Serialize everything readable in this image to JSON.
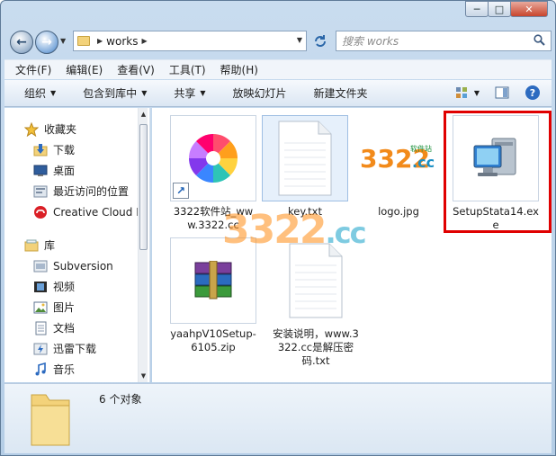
{
  "window": {
    "caption": {
      "minimize": "─",
      "maximize": "□",
      "close": "✕"
    }
  },
  "address": {
    "path": "works",
    "search_placeholder": "搜索 works"
  },
  "menu": [
    "文件(F)",
    "编辑(E)",
    "查看(V)",
    "工具(T)",
    "帮助(H)"
  ],
  "toolbar": {
    "organize": "组织",
    "include_library": "包含到库中",
    "share": "共享",
    "slideshow": "放映幻灯片",
    "new_folder": "新建文件夹"
  },
  "sidebar": {
    "favorites": "收藏夹",
    "favorites_items": [
      "下载",
      "桌面",
      "最近访问的位置",
      "Creative Cloud Fi"
    ],
    "libraries": "库",
    "library_items": [
      "Subversion",
      "视频",
      "图片",
      "文档",
      "迅雷下载",
      "音乐"
    ]
  },
  "files": [
    {
      "name": "3322软件站_www.3322.cc",
      "kind": "shortcut"
    },
    {
      "name": "key.txt",
      "kind": "text"
    },
    {
      "name": "logo.jpg",
      "kind": "image"
    },
    {
      "name": "SetupStata14.exe",
      "kind": "exe"
    },
    {
      "name": "yaahpV10Setup-6105.zip",
      "kind": "zip"
    },
    {
      "name": "安装说明，www.3322.cc是解压密码.txt",
      "kind": "text"
    }
  ],
  "watermark": {
    "digits": "3322",
    "suffix": ".cc"
  },
  "logo_text": {
    "digits": "3322",
    "tag": "软件站",
    "suffix": ".cc"
  },
  "status": {
    "count": "6 个对象"
  },
  "colors": {
    "highlight_box": "#e00000",
    "chrome": "#c9dcef"
  }
}
